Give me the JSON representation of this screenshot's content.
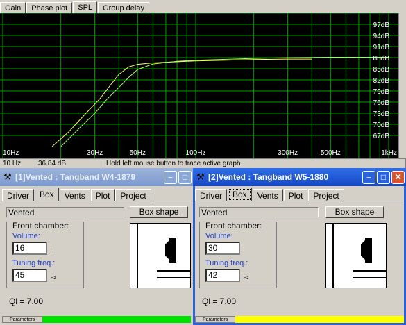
{
  "graph_tabs": [
    "Gain",
    "Phase plot",
    "SPL",
    "Group delay"
  ],
  "graph_tab_active": 2,
  "chart_data": {
    "type": "line",
    "x_scale": "log",
    "xlim": [
      10,
      1000
    ],
    "ylim": [
      64,
      100
    ],
    "x_ticks": [
      "10Hz",
      "30Hz",
      "50Hz",
      "100Hz",
      "300Hz",
      "500Hz",
      "1kHz"
    ],
    "x_tick_values": [
      10,
      30,
      50,
      100,
      300,
      500,
      1000
    ],
    "y_ticks": [
      "97dB",
      "94dB",
      "91dB",
      "88dB",
      "85dB",
      "82dB",
      "79dB",
      "76dB",
      "73dB",
      "70dB",
      "67dB"
    ],
    "y_tick_values": [
      97,
      94,
      91,
      88,
      85,
      82,
      79,
      76,
      73,
      70,
      67
    ],
    "grid": true,
    "background": "#000000",
    "grid_color": "#00a000",
    "series": [
      {
        "color": "#ffff60",
        "x": [
          18,
          22,
          27,
          32,
          36,
          40,
          45,
          50,
          60,
          80,
          100,
          200,
          300,
          400
        ],
        "y": [
          64,
          68,
          73,
          77,
          80.5,
          83.5,
          85.5,
          86.2,
          86.6,
          86.9,
          87.1,
          87.5,
          87.6,
          87.6
        ]
      },
      {
        "color": "#a0ff60",
        "x": [
          20,
          25,
          30,
          35,
          40,
          45,
          50,
          60,
          80,
          100,
          200,
          300,
          500,
          1000
        ],
        "y": [
          64,
          69,
          73,
          77,
          80,
          82.7,
          84.8,
          86.3,
          87,
          87.3,
          87.8,
          88,
          88.1,
          88.1
        ]
      }
    ]
  },
  "status_bar": [
    "10 Hz",
    "36.84 dB",
    "Hold left mouse button to trace active graph"
  ],
  "windows": [
    {
      "title": "[1]Vented : Tangband W4-1879",
      "tabs": [
        "Driver",
        "Box",
        "Vents",
        "Plot",
        "Project"
      ],
      "active_tab": 1,
      "box_type": "Vented",
      "box_shape_label": "Box shape",
      "front_chamber": "Front chamber:",
      "volume_label": "Volume:",
      "volume_value": "16",
      "volume_unit": "l",
      "tuning_label": "Tuning freq.:",
      "tuning_value": "45",
      "tuning_unit": "Hz",
      "ql": "Ql = 7.00",
      "parameters_label": "Parameters",
      "indicator_color": "#00e000"
    },
    {
      "title": "[2]Vented : Tangband W5-1880",
      "tabs": [
        "Driver",
        "Box",
        "Vents",
        "Plot",
        "Project"
      ],
      "active_tab": 1,
      "box_type": "Vented",
      "box_shape_label": "Box shape",
      "front_chamber": "Front chamber:",
      "volume_label": "Volume:",
      "volume_value": "30",
      "volume_unit": "l",
      "tuning_label": "Tuning freq.:",
      "tuning_value": "42",
      "tuning_unit": "Hz",
      "ql": "Ql = 7.00",
      "parameters_label": "Parameters",
      "indicator_color": "#ffff00"
    }
  ]
}
